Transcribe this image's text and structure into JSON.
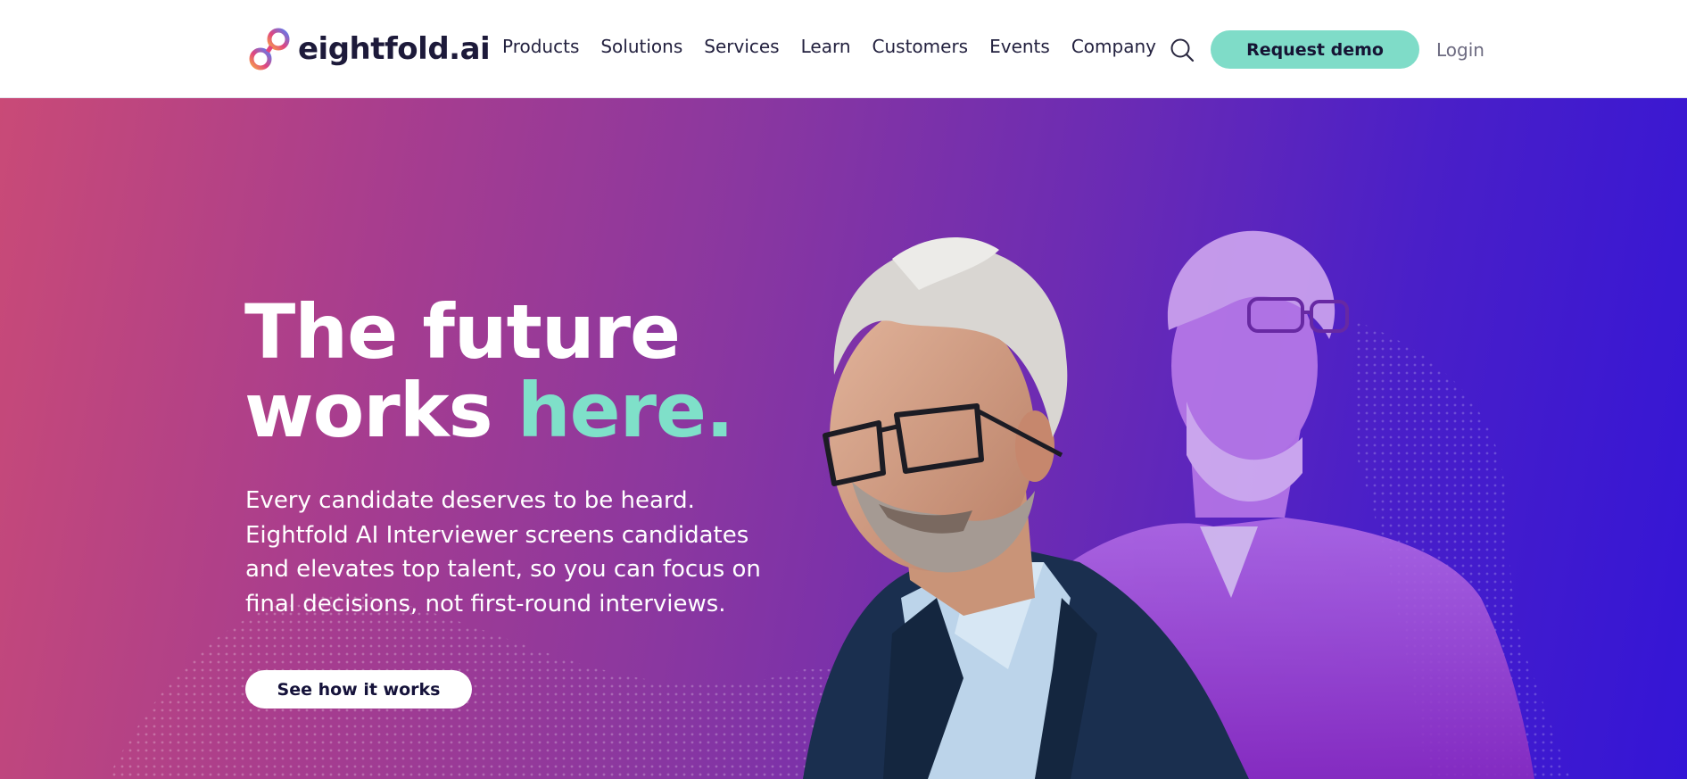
{
  "brand": {
    "name": "eightfold.ai",
    "logo_icon": "infinity-logo-icon"
  },
  "nav": {
    "items": [
      {
        "label": "Products"
      },
      {
        "label": "Solutions"
      },
      {
        "label": "Services"
      },
      {
        "label": "Learn"
      },
      {
        "label": "Customers"
      },
      {
        "label": "Events"
      },
      {
        "label": "Company"
      }
    ],
    "search_icon": "search-icon",
    "request_demo_label": "Request demo",
    "login_label": "Login"
  },
  "hero": {
    "headline_line1": "The future",
    "headline_line2_prefix": "works ",
    "headline_line2_accent": "here.",
    "subtext": "Every candidate deserves to be heard. Eightfold AI Interviewer screens candidates and elevates top talent, so you can focus on final decisions, not first-round interviews.",
    "cta_label": "See how it works"
  },
  "colors": {
    "accent": "#7fdcc8",
    "gradient_start": "#c94a77",
    "gradient_mid": "#8a37a0",
    "gradient_end": "#3415d6",
    "text_dark": "#1d1a3a"
  }
}
